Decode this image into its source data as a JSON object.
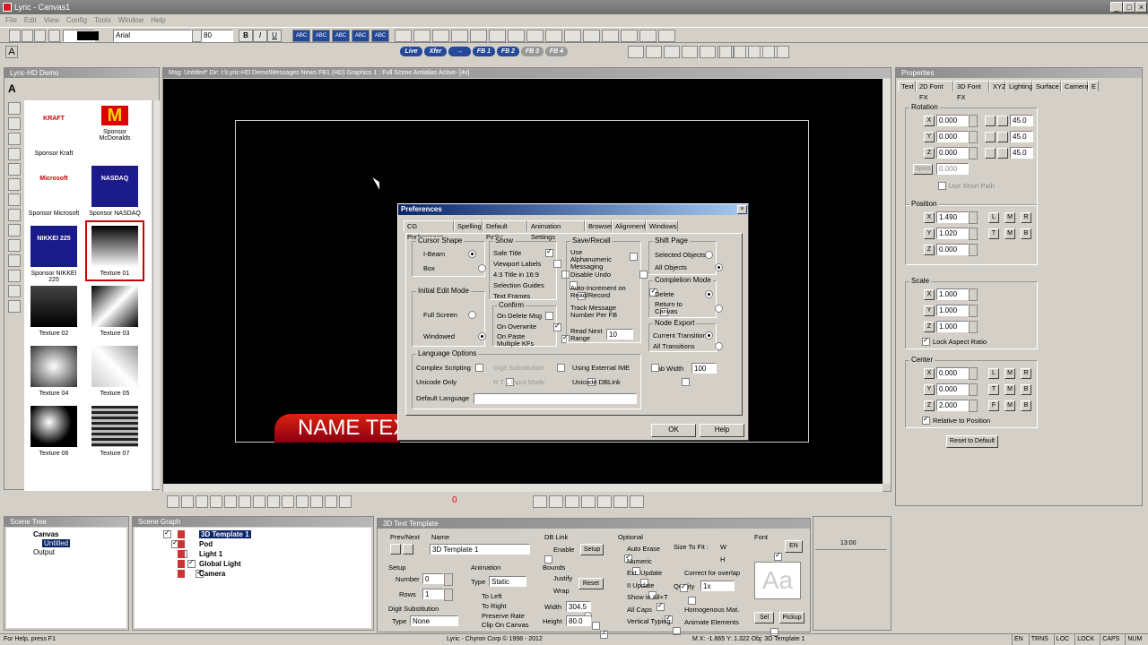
{
  "app": {
    "title": "Lyric - Canvas1"
  },
  "menu": [
    "File",
    "Edit",
    "View",
    "Config",
    "Tools",
    "Window",
    "Help"
  ],
  "toolbar": {
    "font_name": "Arial",
    "font_size": "80",
    "fmt_b": "B",
    "fmt_i": "I",
    "fmt_u": "U",
    "fx_buttons": [
      "ABC",
      "ABC",
      "ABC",
      "ABC",
      "ABC"
    ],
    "mode_buttons": [
      "Live",
      "Xfer",
      "→",
      "FB 1",
      "FB 2",
      "FB 3",
      "FB 4"
    ]
  },
  "left_panel": {
    "title": "Lyric-HD Demo",
    "thumbs": [
      {
        "label": "Sponsor Kraft",
        "logo": "KRAFT"
      },
      {
        "label": "Sponsor McDonalds",
        "logo": "M"
      },
      {
        "label": "Sponsor Microsoft",
        "logo": "Microsoft"
      },
      {
        "label": "Sponsor NASDAQ",
        "logo": "NASDAQ"
      },
      {
        "label": "Sponsor NIKKEI 225",
        "logo": "NIKKEI 225"
      },
      {
        "label": "Texture 01",
        "logo": ""
      },
      {
        "label": "Texture 02",
        "logo": ""
      },
      {
        "label": "Texture 03",
        "logo": ""
      },
      {
        "label": "Texture 04",
        "logo": ""
      },
      {
        "label": "Texture 05",
        "logo": ""
      },
      {
        "label": "Texture 06",
        "logo": ""
      },
      {
        "label": "Texture 07",
        "logo": ""
      }
    ]
  },
  "canvas": {
    "title": "Msg: Untitled*  Dir: I:\\Lyric-HD Demo\\Messages News  FB1 (HD) Graphics 1 : Full Scene Antialias Active-  [4x]",
    "name_text": "NAME TEX",
    "counter": "0"
  },
  "prefs": {
    "title": "Preferences",
    "tabs": [
      "CG Preferences",
      "Spelling",
      "Default Paths",
      "Animation Settings",
      "Browser",
      "Alignment",
      "Windows"
    ],
    "cursor_shape": {
      "label": "Cursor Shape",
      "ibeam": "I-Beam",
      "box": "Box"
    },
    "initial_edit": {
      "label": "Initial Edit Mode",
      "full": "Full Screen",
      "windowed": "Windowed"
    },
    "show": {
      "label": "Show",
      "items": [
        "Safe Title",
        "Viewport Labels",
        "4:3 Title in 16:9",
        "Selection Guides",
        "Text Frames"
      ]
    },
    "confirm": {
      "label": "Confirm",
      "items": [
        "On Delete Msg",
        "On Overwrite",
        "On Paste Multiple KFs"
      ]
    },
    "save_recall": {
      "label": "Save/Recall",
      "items": [
        "Use Alphanumeric Messaging",
        "Disable Undo",
        "Auto-Increment on Read/Record",
        "Track Message Number Per FB"
      ],
      "read_next_label": "Read Next Range",
      "read_next_value": "10"
    },
    "shift_page": {
      "label": "Shift Page",
      "items": [
        "Selected Objects",
        "All Objects"
      ]
    },
    "completion": {
      "label": "Completion Mode",
      "items": [
        "Delete",
        "Return to Canvas"
      ]
    },
    "node_export": {
      "label": "Node Export",
      "items": [
        "Current Transition",
        "All Transitions"
      ]
    },
    "language": {
      "label": "Language Options",
      "complex": "Complex Scripting",
      "digit": "Digit Substitution",
      "ext_ime": "Using External IME",
      "unicode_only": "Unicode Only",
      "rtl": "R T L Input Mode",
      "unicode_db": "Unicode DBLink",
      "default_lang": "Default Language"
    },
    "tab_width_label": "Tab Width",
    "tab_width": "100",
    "ok": "OK",
    "help": "Help"
  },
  "properties": {
    "title": "Properties",
    "tabs": [
      "Text",
      "2D Font FX",
      "3D Font FX",
      "XYZ",
      "Lighting",
      "Surface",
      "Camera",
      "E"
    ],
    "rotation": {
      "label": "Rotation",
      "x": "0.000",
      "y": "0.000",
      "z": "0.000",
      "spins": "0.000",
      "sx": "45.0",
      "sy": "45.0",
      "sz": "45.0",
      "spins_label": "Spins",
      "short_path": "Use Short Path"
    },
    "position": {
      "label": "Position",
      "x": "1.490",
      "y": "1.020",
      "z": "0.000"
    },
    "scale": {
      "label": "Scale",
      "x": "1.000",
      "y": "1.000",
      "z": "1.000",
      "lock": "Lock Aspect Ratio"
    },
    "center": {
      "label": "Center",
      "x": "0.000",
      "y": "0.000",
      "z": "2.000",
      "rel": "Relative to Position"
    },
    "reset": "Reset to Default",
    "axis": [
      "X",
      "Y",
      "Z"
    ],
    "lmr": [
      "L",
      "M",
      "R"
    ],
    "tmb": [
      "T",
      "M",
      "B"
    ],
    "fmb": [
      "F",
      "M",
      "B"
    ]
  },
  "scene_tree": {
    "title": "Scene Tree",
    "root": "Canvas",
    "items": [
      "Untitled",
      "Output"
    ]
  },
  "scene_graph": {
    "title": "Scene Graph",
    "items": [
      "3D Template 1",
      "Pod",
      "Light 1",
      "Global Light",
      "Camera"
    ]
  },
  "template": {
    "title": "3D Text Template",
    "prev_next": "Prev/Next",
    "name_label": "Name",
    "name": "3D Template 1",
    "dblink": "DB Link",
    "enable": "Enable",
    "setup_btn": "Setup",
    "optional": "Optional",
    "opt_items": [
      "Auto Erase",
      "Numeric",
      "Ext. Update",
      "II Update",
      "Show in All+T",
      "All Caps",
      "Vertical Typing"
    ],
    "size_to_fit": "Size To Fit :",
    "w": "W",
    "h": "H",
    "correct": "Correct for overlap",
    "quality": "Quality",
    "quality_val": "1x",
    "homog": "Homogenous Mat.",
    "animate": "Animate Elements",
    "font": "Font",
    "en": "EN",
    "aa": "Aa",
    "sel": "Sel",
    "pickup": "Pickup",
    "setup": "Setup",
    "number": "Number",
    "number_val": "0",
    "rows": "Rows",
    "rows_val": "1",
    "digit_sub": "Digit Substitution",
    "type": "Type",
    "type_val": "None",
    "animation": "Animation",
    "anim_type_val": "Static",
    "to_left": "To Left",
    "to_right": "To Right",
    "preserve": "Preserve Rate",
    "clip": "Clip On Canvas",
    "bounds": "Bounds",
    "justify": "Justify",
    "wrap": "Wrap",
    "reset": "Reset",
    "width": "Width",
    "width_val": "304.5",
    "height": "Height",
    "height_val": "80.0",
    "timeline": "13:00"
  },
  "status": {
    "help": "For Help, press F1",
    "copyright": "Lyric - Chyron Corp © 1998 - 2012",
    "coords": "M   X: -1.865  Y: 1.322  Obj: 3D Template 1",
    "ind": [
      "EN",
      "TRNS",
      "LOC",
      "LOCK",
      "CAPS",
      "NUM"
    ]
  }
}
